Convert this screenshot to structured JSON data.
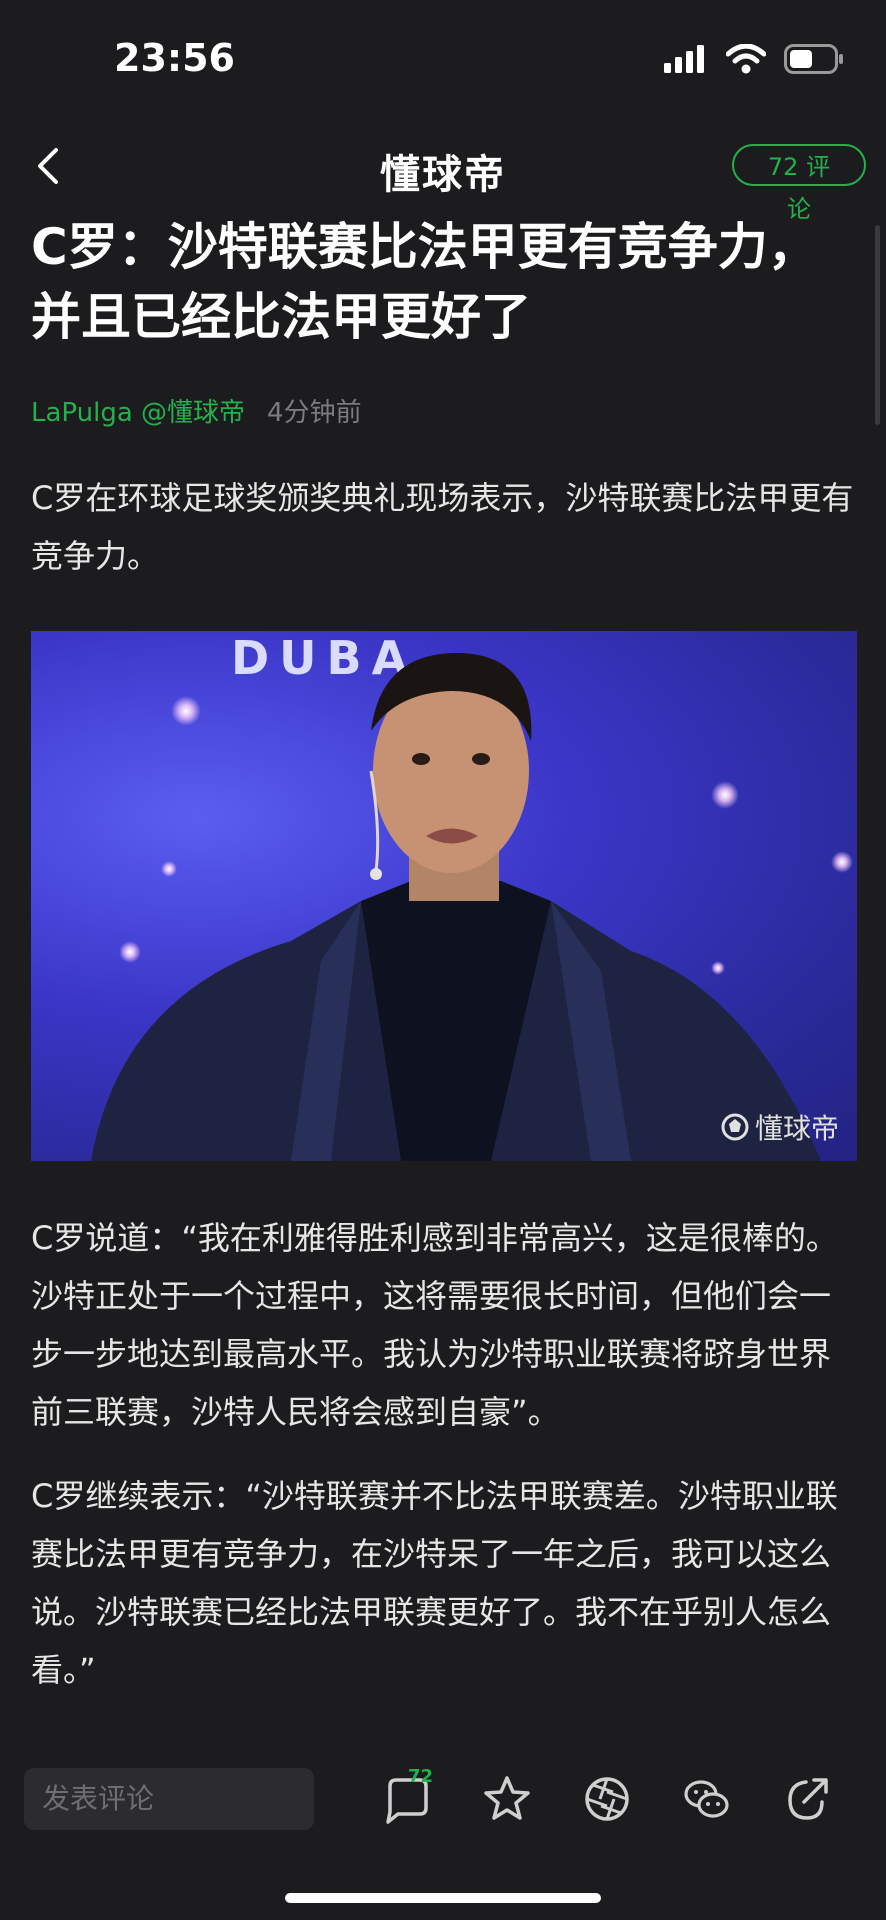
{
  "status": {
    "time": "23:56"
  },
  "nav": {
    "logo": "懂球帝",
    "comment_pill": "72 评论"
  },
  "article": {
    "title": "C罗：沙特联赛比法甲更有竞争力，并且已经比法甲更好了",
    "author": "LaPulga @懂球帝",
    "time_ago": "4分钟前",
    "paragraphs": [
      "C罗在环球足球奖颁奖典礼现场表示，沙特联赛比法甲更有竞争力。",
      "C罗说道：“我在利雅得胜利感到非常高兴，这是很棒的。沙特正处于一个过程中，这将需要很长时间，但他们会一步一步地达到最高水平。我认为沙特职业联赛将跻身世界前三联赛，沙特人民将会感到自豪”。",
      "C罗继续表示：“沙特联赛并不比法甲联赛差。沙特职业联赛比法甲更有竞争力，在沙特呆了一年之后，我可以这么说。沙特联赛已经比法甲联赛更好了。我不在乎别人怎么看。”"
    ],
    "image": {
      "backdrop_text": "DUBA",
      "watermark": "懂球帝"
    }
  },
  "bottom_bar": {
    "input_placeholder": "发表评论",
    "comment_count": "72",
    "icons": [
      "comment-icon",
      "star-icon",
      "aperture-icon",
      "wechat-icon",
      "share-icon"
    ]
  },
  "colors": {
    "accent": "#23b14d",
    "background": "#1c1c1e"
  }
}
